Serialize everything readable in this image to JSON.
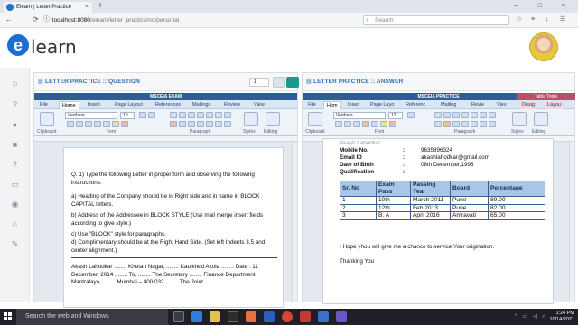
{
  "browser": {
    "tab_title": "Elearn | Letter Practice",
    "new_tab_symbol": "+",
    "close_tab_symbol": "×",
    "url_host": "localhost:8080",
    "url_path": "/elearn/letter_practice/no/personal",
    "search_placeholder": "Search",
    "back_symbol": "←",
    "refresh_symbol": "⟳",
    "info_symbol": "ⓘ",
    "window_controls": "–  □  ×"
  },
  "app": {
    "logo_letter": "e",
    "logo_word": "learn"
  },
  "question_panel": {
    "title": "LETTER PRACTICE :: QUESTION",
    "page_number": "1",
    "doc_title": "MSCEIA EXAM",
    "menu": [
      "File",
      "Home",
      "Insert",
      "Page Layout",
      "References",
      "Mailings",
      "Review",
      "View"
    ],
    "font_name": "Verdana",
    "font_size": "10",
    "group_labels": [
      "Clipboard",
      "Font",
      "Paragraph",
      "Styles",
      "Editing"
    ],
    "text": {
      "intro": "Q. 1) Type the following Letter in proper form and observing the following instructions.",
      "a": "a) Heading of the Company should be in Right side and in name in BLOCK CAPITAL letters.",
      "b": "b) Address of the Addressee in BLOCK STYLE (Use mail merge insert fields according to give style.)",
      "c": "c) Use \"BLOCK\" style for paragraphs.",
      "d": "d) Complimentary should be at the Right Hand Side. (Set left Indents 3.5 and center alignment.)",
      "letter": "Akash Lahodkar ........ Khetan Nagar, ........ Kaulkhed Akola ........ Date : 11 December, 2014 ........ To, ........ The Secretary ........ Finance Department, Mantralaya, ........ Mumbai – 400 032 ........ The Joint"
    }
  },
  "answer_panel": {
    "title": "LETTER PRACTICE :: ANSWER",
    "doc_title": "MSCEIA PRACTICE",
    "table_tools": "Table Tools",
    "menu": [
      "File",
      "Hom",
      "Inser",
      "Page Layo",
      "Referenc",
      "Mailing",
      "Revie",
      "Viev",
      "Desig",
      "Layou"
    ],
    "font_name": "Verdana",
    "font_size": "12",
    "group_labels": [
      "Clipboard",
      "Font",
      "Paragraph",
      "Styles",
      "Editing"
    ],
    "partial_top": "Akash Lahodkar",
    "fields": [
      {
        "label": "Mobile No.",
        "sep": ":",
        "value": "9635896324"
      },
      {
        "label": "Email ID",
        "sep": ":",
        "value": "akashlahodkar@gmail.com"
      },
      {
        "label": "Date of Birth",
        "sep": ":",
        "value": "08th December,1996"
      },
      {
        "label": "Qualification",
        "sep": ":",
        "value": ""
      }
    ],
    "table": {
      "headers": [
        "Sr. No",
        "Exam Pass",
        "Passing Year",
        "Board",
        "Percentage"
      ],
      "rows": [
        [
          "1",
          "10th",
          "March 2011",
          "Pune",
          "89.00"
        ],
        [
          "2",
          "12th",
          "Feb 2013",
          "Pune",
          "82.00"
        ],
        [
          "3",
          "B. A",
          "April 2016",
          "Amravati",
          "65.00"
        ]
      ]
    },
    "closing": "I Hope yhou will give me a chance to service Your origination.",
    "thanks": "Thanking You"
  },
  "taskbar": {
    "search_placeholder": "Search the web and Windows",
    "time": "1:24 PM",
    "date": "10/14/2021"
  },
  "colors": {
    "accent": "#2c6fb5",
    "word_titlebar": "#2f5e96",
    "table_header": "#a8c7e8"
  }
}
